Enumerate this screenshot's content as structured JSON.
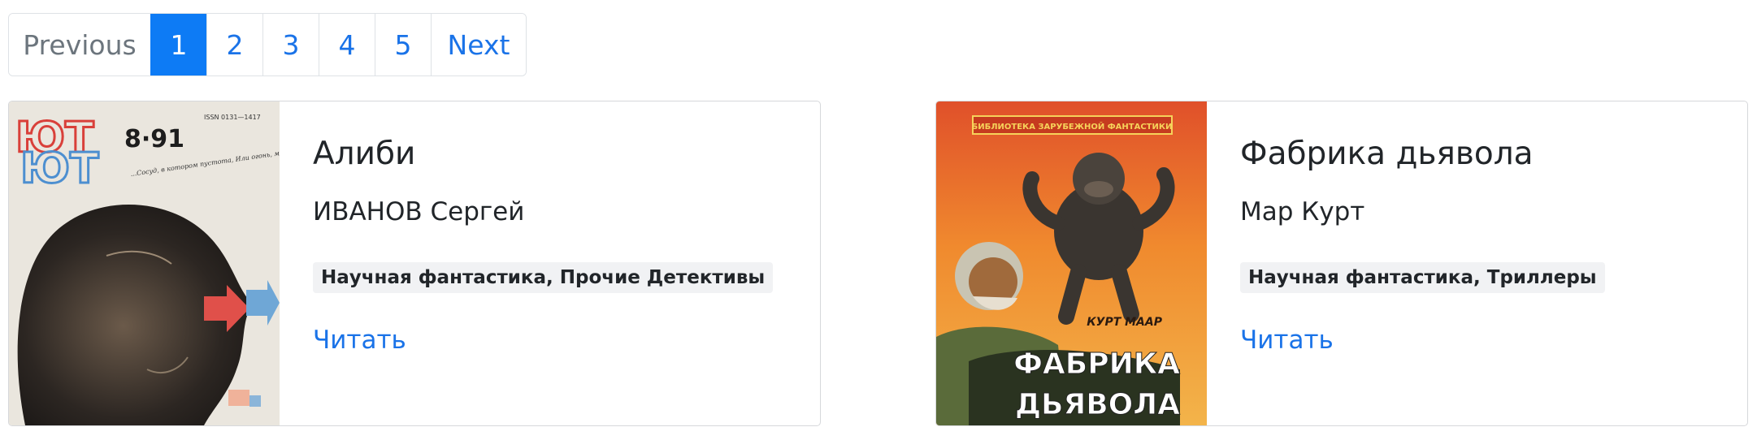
{
  "pagination": {
    "previous_label": "Previous",
    "next_label": "Next",
    "pages": [
      "1",
      "2",
      "3",
      "4",
      "5"
    ],
    "active_page": "1"
  },
  "books": [
    {
      "title": "Алиби",
      "author": "ИВАНОВ Сергей",
      "genres": "Научная фантастика, Прочие Детективы",
      "read_label": "Читать",
      "cover": {
        "masthead": "ЮТ",
        "issue": "8·91",
        "issn": "ISSN 0131—1417",
        "tagline": "...Сосуд, в котором пустота, Или огонь, мерцающий в сосуде?"
      }
    },
    {
      "title": "Фабрика дьявола",
      "author": "Мар Курт",
      "genres": "Научная фантастика, Триллеры",
      "read_label": "Читать",
      "cover": {
        "series": "БИБЛИОТЕКА ЗАРУБЕЖНОЙ ФАНТАСТИКИ",
        "author": "КУРТ МААР",
        "title_line1": "ФАБРИКА",
        "title_line2": "ДЬЯВОЛА"
      }
    }
  ],
  "colors": {
    "link": "#1a73e8",
    "active_page_bg": "#0d7bf5",
    "disabled_text": "#6c757d",
    "badge_bg": "#f1f2f4"
  }
}
